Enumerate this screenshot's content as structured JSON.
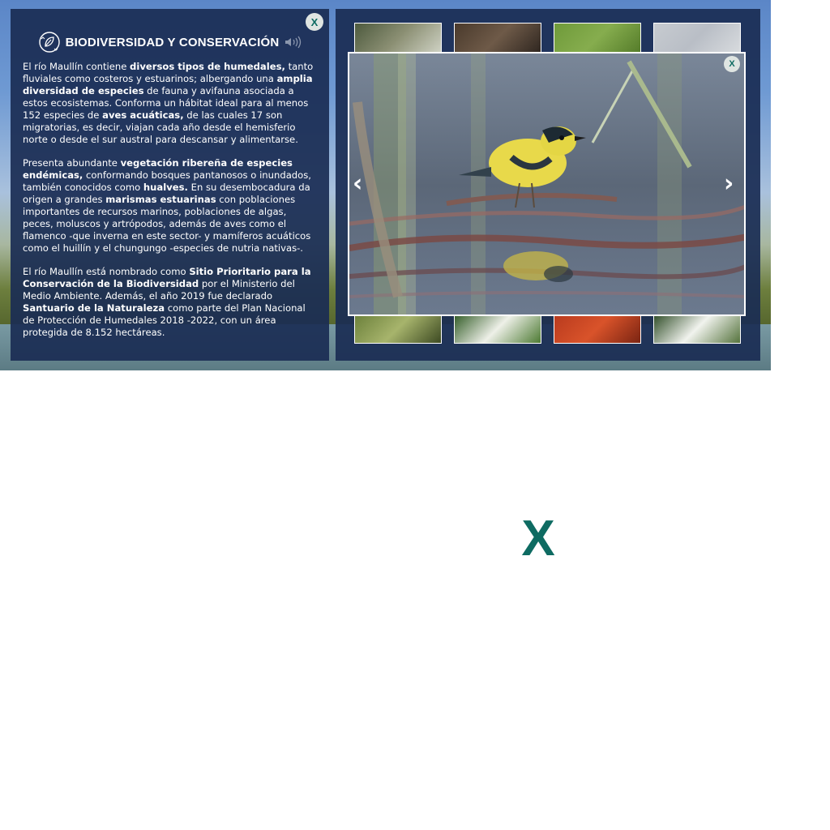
{
  "info_panel": {
    "title": "BIODIVERSIDAD Y CONSERVACIÓN",
    "close_label": "X",
    "paragraphs": [
      [
        {
          "t": "El río Maullín contiene ",
          "b": false
        },
        {
          "t": "diversos tipos de humedales,",
          "b": true
        },
        {
          "t": " tanto fluviales como costeros y estuarinos; albergando una ",
          "b": false
        },
        {
          "t": "amplia diversidad de especies",
          "b": true
        },
        {
          "t": " de fauna y avifauna asociada a estos ecosistemas. Conforma un hábitat ideal para al menos 152 especies de ",
          "b": false
        },
        {
          "t": "aves acuáticas,",
          "b": true
        },
        {
          "t": " de las cuales 17 son migratorias, es decir, viajan cada año desde el hemisferio norte o desde el sur austral para descansar y alimentarse.",
          "b": false
        }
      ],
      [
        {
          "t": "Presenta abundante ",
          "b": false
        },
        {
          "t": "vegetación ribereña de especies endémicas,",
          "b": true
        },
        {
          "t": " conformando bosques pantanosos o inundados, también conocidos como ",
          "b": false
        },
        {
          "t": "hualves.",
          "b": true
        },
        {
          "t": " En su desembocadura da origen a grandes ",
          "b": false
        },
        {
          "t": "marismas estuarinas",
          "b": true
        },
        {
          "t": " con poblaciones importantes de recursos marinos, poblaciones de algas, peces, moluscos y artrópodos, además de aves como el flamenco -que inverna en este sector- y mamíferos acuáticos como el huillín y el chungungo -especies de nutria nativas-.",
          "b": false
        }
      ],
      [
        {
          "t": "El río Maullín está nombrado como ",
          "b": false
        },
        {
          "t": "Sitio Prioritario para la Conservación de la Biodiversidad",
          "b": true
        },
        {
          "t": " por el Ministerio del Medio Ambiente. Además, el año 2019 fue declarado ",
          "b": false
        },
        {
          "t": "Santuario de la Naturaleza",
          "b": true
        },
        {
          "t": " como parte del Plan Nacional de Protección de Humedales 2018 -2022, con un área protegida de 8.152 hectáreas.",
          "b": false
        }
      ]
    ]
  },
  "gallery": {
    "lightbox_close_label": "X",
    "prev_label": "‹",
    "next_label": "›",
    "thumbnails_top": [
      {
        "subject": "reeds",
        "colors": [
          "#4d5a3e",
          "#8b8f73",
          "#cfd2c4"
        ]
      },
      {
        "subject": "brown-leaves",
        "colors": [
          "#4a3a2c",
          "#6e5a48",
          "#2f2620"
        ]
      },
      {
        "subject": "green-grass",
        "colors": [
          "#6f9a3a",
          "#86ad4e",
          "#557c2a"
        ]
      },
      {
        "subject": "grey-sky",
        "colors": [
          "#c7cbd0",
          "#b9bec6",
          "#d8dbde"
        ]
      }
    ],
    "thumbnails_bottom": [
      {
        "subject": "reeds-water",
        "colors": [
          "#6a7f3a",
          "#a7b46c",
          "#3d4a22"
        ]
      },
      {
        "subject": "white-flowers-leaves",
        "colors": [
          "#2f5a24",
          "#eef0e8",
          "#4d7a33"
        ]
      },
      {
        "subject": "red-flowers",
        "colors": [
          "#b83a1e",
          "#d9532a",
          "#7a2412"
        ]
      },
      {
        "subject": "white-flowers",
        "colors": [
          "#2c4a24",
          "#f1f3ee",
          "#55733d"
        ]
      }
    ]
  },
  "bottom_close_label": "X",
  "colors": {
    "panel_bg": "#1a2c54",
    "accent_teal": "#0e6b62",
    "close_btn_bg": "#dfe5e2"
  }
}
